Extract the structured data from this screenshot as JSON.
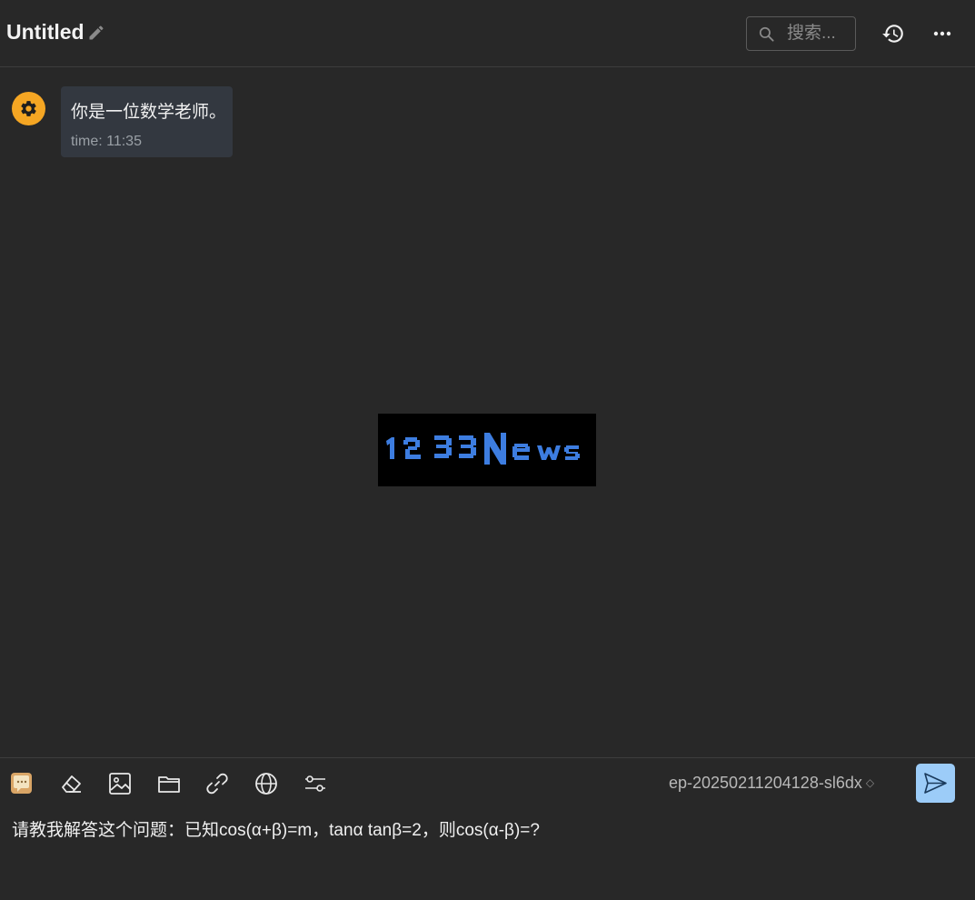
{
  "header": {
    "title": "Untitled",
    "search_placeholder": "搜索..."
  },
  "messages": [
    {
      "role": "system",
      "avatar_icon": "gear-icon",
      "text": "你是一位数学老师。",
      "time": "time: 11:35"
    }
  ],
  "watermark": {
    "text": "1233News",
    "color": "#3d7de0"
  },
  "toolbar": {
    "tools": [
      "chat-icon",
      "eraser-icon",
      "image-icon",
      "folder-icon",
      "link-icon",
      "globe-icon",
      "settings-sliders-icon"
    ],
    "model": "ep-20250211204128-sl6dx"
  },
  "input": {
    "value": "请教我解答这个问题：已知cos(α+β)=m，tanα tanβ=2，则cos(α-β)=?"
  },
  "colors": {
    "background": "#282828",
    "avatar": "#f5a623",
    "bubble": "#333840",
    "send_button": "#9cccf8"
  }
}
